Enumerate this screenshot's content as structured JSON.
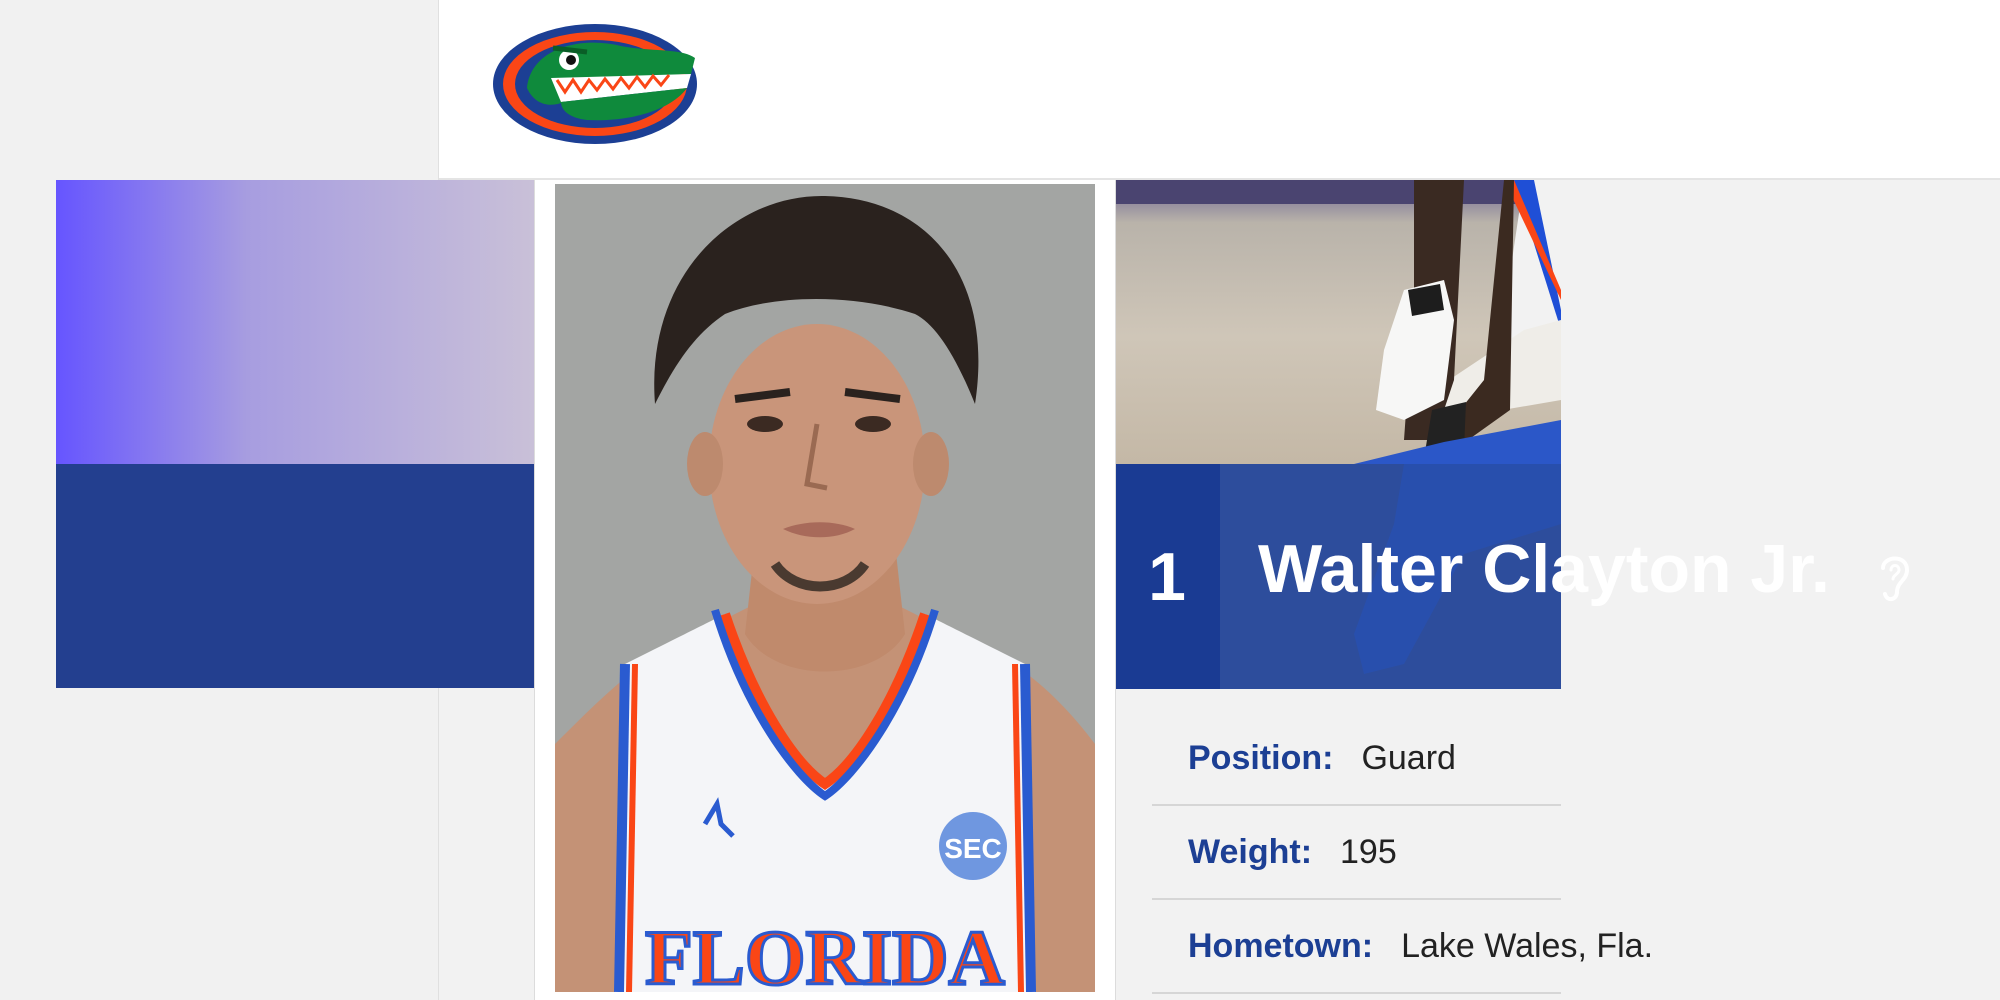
{
  "header": {
    "logo_icon": "gator-logo-icon"
  },
  "player": {
    "number": "1",
    "name": "Walter Clayton Jr.",
    "audio_icon": "ear-icon",
    "photo_jersey_text": "FLORIDA",
    "photo_patch_text": "SEC"
  },
  "details": [
    {
      "label": "Position:",
      "value": "Guard"
    },
    {
      "label": "Weight:",
      "value": "195"
    },
    {
      "label": "Hometown:",
      "value": "Lake Wales, Fla."
    }
  ],
  "colors": {
    "brand_blue": "#1c3f94",
    "brand_orange": "#fa4616"
  }
}
